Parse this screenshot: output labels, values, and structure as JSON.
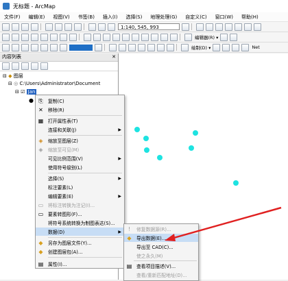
{
  "window": {
    "title": "无标题 - ArcMap"
  },
  "menubar": [
    "文件(F)",
    "编辑(E)",
    "视图(V)",
    "书签(B)",
    "插入(I)",
    "选择(S)",
    "地理处理(G)",
    "自定义(C)",
    "窗口(W)",
    "帮助(H)"
  ],
  "toolbar": {
    "scale_value": "1:140, 545, 993",
    "editor_label": "编辑器(R) ▾",
    "draw_label": "绘制(D) ▾",
    "net_label": "Net"
  },
  "toc": {
    "title": "内容列表",
    "close_glyph": "✕",
    "layers_root": "图层",
    "folder_path": "C:\\Users\\Administrator\\Document",
    "selected_layer": "Jan"
  },
  "context_menu": [
    {
      "label": "复制(C)",
      "icon": "copy-icon",
      "glyph": "⎘",
      "enabled": true
    },
    {
      "label": "移除(R)",
      "icon": "remove-icon",
      "glyph": "✕",
      "enabled": true
    },
    {
      "label": "打开属性表(T)",
      "icon": "table-icon",
      "glyph": "▦",
      "enabled": true
    },
    {
      "label": "连接和关联(J)",
      "icon": "",
      "glyph": "",
      "enabled": true,
      "submenu": true
    },
    {
      "label": "缩放至图层(Z)",
      "icon": "zoom-layer-icon",
      "glyph": "◈",
      "enabled": true
    },
    {
      "label": "缩放至可见(M)",
      "icon": "zoom-visible-icon",
      "glyph": "◈",
      "enabled": false
    },
    {
      "label": "可见比例范围(V)",
      "icon": "",
      "glyph": "",
      "enabled": true,
      "submenu": true
    },
    {
      "label": "使用符号级别(L)",
      "icon": "",
      "glyph": "",
      "enabled": true
    },
    {
      "label": "选择(S)",
      "icon": "",
      "glyph": "",
      "enabled": true,
      "submenu": true
    },
    {
      "label": "标注要素(L)",
      "icon": "",
      "glyph": "",
      "enabled": true
    },
    {
      "label": "编辑要素(E)",
      "icon": "",
      "glyph": "",
      "enabled": true,
      "submenu": true
    },
    {
      "label": "将标注转换为注记(I)...",
      "icon": "annotation-icon",
      "glyph": "▭",
      "enabled": false
    },
    {
      "label": "要素转图形(F)...",
      "icon": "convert-icon",
      "glyph": "▭",
      "enabled": true
    },
    {
      "label": "将符号系统转换为制图表达(S)...",
      "icon": "",
      "glyph": "",
      "enabled": true
    },
    {
      "label": "数据(D)",
      "icon": "",
      "glyph": "",
      "enabled": true,
      "submenu": true,
      "highlight": true
    },
    {
      "label": "另存为图层文件(Y)...",
      "icon": "save-layer-icon",
      "glyph": "◆",
      "enabled": true
    },
    {
      "label": "创建图层包(A)...",
      "icon": "layer-package-icon",
      "glyph": "◆",
      "enabled": true
    },
    {
      "label": "属性(I)...",
      "icon": "properties-icon",
      "glyph": "▤",
      "enabled": true
    }
  ],
  "submenu": [
    {
      "label": "修复数据源(R)...",
      "glyph": "!",
      "enabled": false
    },
    {
      "label": "导出数据(E)...",
      "glyph": "◆",
      "enabled": true,
      "highlight": true
    },
    {
      "label": "导出至 CAD(C)...",
      "glyph": "",
      "enabled": true
    },
    {
      "label": "使之永久(M)",
      "glyph": "",
      "enabled": false
    },
    {
      "label": "查看项目描述(V)...",
      "glyph": "▤",
      "enabled": true
    },
    {
      "label": "查看/重新匹配地址(D)...",
      "glyph": "",
      "enabled": false
    }
  ],
  "colors": {
    "point": "#1ee3e1",
    "arrow": "#e02020",
    "highlight": "#c7ddf5"
  }
}
